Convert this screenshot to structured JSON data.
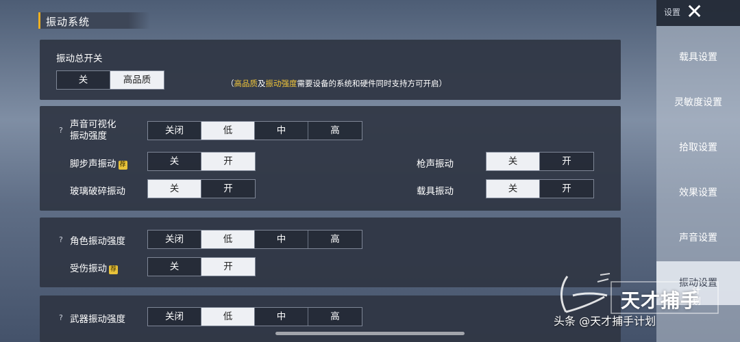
{
  "header": {
    "title": "振动系统"
  },
  "master": {
    "label": "振动总开关",
    "options": [
      "关",
      "高品质"
    ],
    "selected": 1,
    "note": {
      "open": "（",
      "hl1": "高品质",
      "mid1": "及",
      "hl2": "振动强度",
      "rest": "需要设备的系统和硬件同时支持方可开启",
      "close": "）"
    }
  },
  "sound": {
    "help": "?",
    "intensity_label_line1": "声音可视化",
    "intensity_label_line2": "振动强度",
    "intensity_options": [
      "关闭",
      "低",
      "中",
      "高"
    ],
    "intensity_selected": 1,
    "footstep_label": "脚步声振动",
    "footstep_badge": "荐",
    "footstep_options": [
      "关",
      "开"
    ],
    "footstep_selected": 1,
    "glass_label": "玻璃破碎振动",
    "glass_options": [
      "关",
      "开"
    ],
    "glass_selected": 0,
    "gunshot_label": "枪声振动",
    "gunshot_options": [
      "关",
      "开"
    ],
    "gunshot_selected": 0,
    "vehicle_label": "载具振动",
    "vehicle_options": [
      "关",
      "开"
    ],
    "vehicle_selected": 0
  },
  "character": {
    "help": "?",
    "intensity_label": "角色振动强度",
    "intensity_options": [
      "关闭",
      "低",
      "中",
      "高"
    ],
    "intensity_selected": 1,
    "hurt_label": "受伤振动",
    "hurt_badge": "荐",
    "hurt_options": [
      "关",
      "开"
    ],
    "hurt_selected": 1
  },
  "weapon": {
    "help": "?",
    "intensity_label": "武器振动强度",
    "intensity_options": [
      "关闭",
      "低",
      "中",
      "高"
    ],
    "intensity_selected": 1
  },
  "sidebar": {
    "settings_label": "设置",
    "close_icon": "close-icon",
    "items": [
      {
        "label": "载具设置",
        "active": false
      },
      {
        "label": "灵敏度设置",
        "active": false
      },
      {
        "label": "拾取设置",
        "active": false
      },
      {
        "label": "效果设置",
        "active": false
      },
      {
        "label": "声音设置",
        "active": false
      },
      {
        "label": "振动设置",
        "active": true
      }
    ]
  },
  "watermark": {
    "big": "天才捕手",
    "small": "计划"
  },
  "credit": "头条 @天才捕手计划",
  "colors": {
    "accent": "#f0b020",
    "highlight": "#f0c53a",
    "selected_bg": "#eef0f4",
    "panel": "#2f3644"
  }
}
